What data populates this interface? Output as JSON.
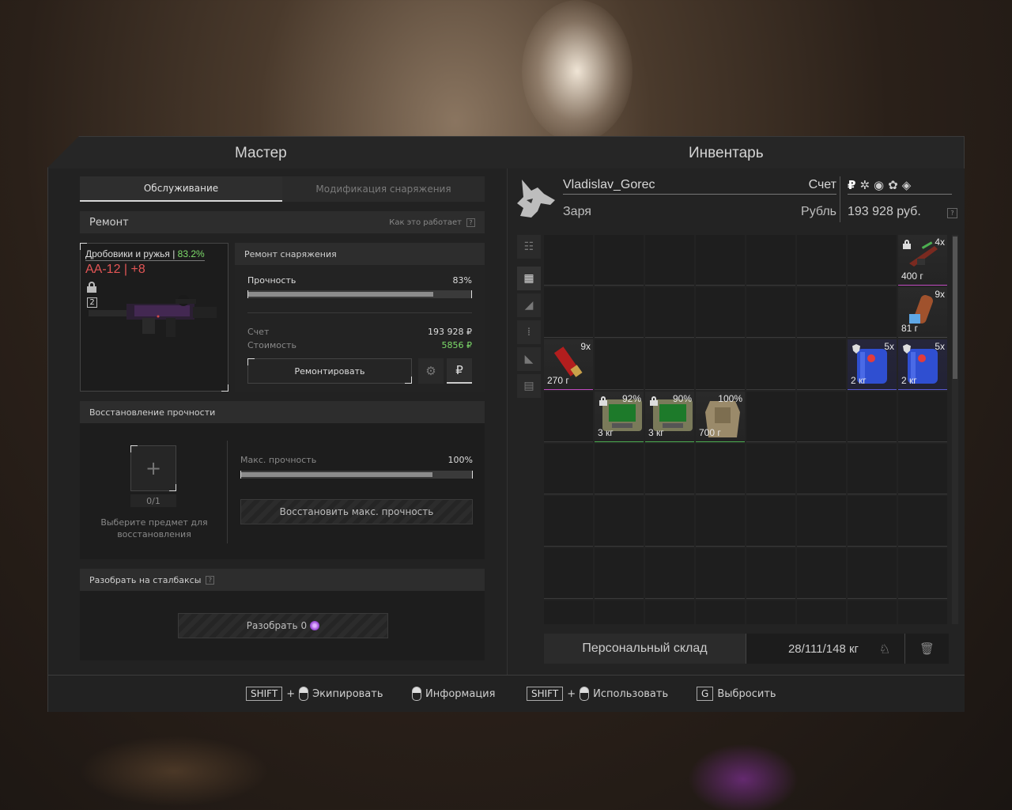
{
  "left_title": "Мастер",
  "right_title": "Инвентарь",
  "tabs": [
    {
      "label": "Обслуживание",
      "active": true
    },
    {
      "label": "Модификация снаряжения",
      "active": false
    }
  ],
  "repair": {
    "header": "Ремонт",
    "how_it_works": "Как это работает",
    "item": {
      "category": "Дробовики и ружья",
      "category_percent": "83.2%",
      "name": "АА-12 | +8",
      "badge": "2"
    },
    "panel_title": "Ремонт снаряжения",
    "durability_label": "Прочность",
    "durability_value": "83%",
    "durability_fraction": 0.83,
    "account_label": "Счет",
    "account_value": "193 928 ₽",
    "cost_label": "Стоимость",
    "cost_value": "5856 ₽",
    "repair_button": "Ремонтировать",
    "currency_button": "₽"
  },
  "restore": {
    "header": "Восстановление прочности",
    "slot_count": "0/1",
    "slot_hint": "Выберите предмет для восстановления",
    "max_label": "Макс. прочность",
    "max_value": "100%",
    "max_fraction": 0.83,
    "button": "Восстановить макс. прочность"
  },
  "disassemble": {
    "header": "Разобрать на сталбаксы",
    "button": "Разобрать",
    "amount": "0"
  },
  "player": {
    "name": "Vladislav_Gorec",
    "faction": "Заря",
    "account_label": "Счет",
    "currency_label": "Рубль",
    "balance": "193 928 руб."
  },
  "inventory_items": [
    {
      "col": 7,
      "row": 0,
      "count": "4x",
      "weight": "400 г",
      "kind": "weapon"
    },
    {
      "col": 7,
      "row": 1,
      "count": "9x",
      "weight": "81 г",
      "kind": "ammo"
    },
    {
      "col": 0,
      "row": 2,
      "count": "9x",
      "weight": "270 г",
      "kind": "shell"
    },
    {
      "col": 6,
      "row": 2,
      "count": "5x",
      "weight": "2 кг",
      "kind": "canister"
    },
    {
      "col": 7,
      "row": 2,
      "count": "5x",
      "weight": "2 кг",
      "kind": "canister"
    },
    {
      "col": 1,
      "row": 3,
      "count": "92%",
      "weight": "3 кг",
      "kind": "device"
    },
    {
      "col": 2,
      "row": 3,
      "count": "90%",
      "weight": "3 кг",
      "kind": "device"
    },
    {
      "col": 3,
      "row": 3,
      "count": "100%",
      "weight": "700 г",
      "kind": "vest"
    }
  ],
  "storage": {
    "label": "Персональный склад",
    "weight": "28/111/148 кг"
  },
  "footer": {
    "shift": "SHIFT",
    "plus": "+",
    "equip": "Экипировать",
    "info": "Информация",
    "use": "Использовать",
    "drop_key": "G",
    "drop": "Выбросить"
  },
  "colors": {
    "green": "#7ddc6a",
    "red": "#e25555",
    "accent": "#d8d8d8"
  }
}
